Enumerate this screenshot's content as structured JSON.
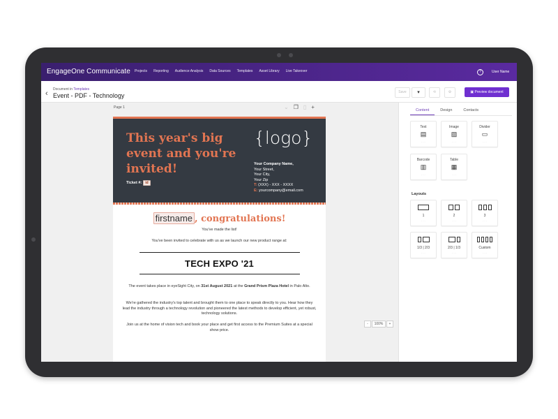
{
  "topbar": {
    "brand": "EngageOne Communicate",
    "nav": [
      "Projects",
      "Reporting",
      "Audience Analysis",
      "Data Sources",
      "Templates",
      "Asset Library",
      "Live Takeover"
    ],
    "help_icon": "?",
    "user_name": "User Name"
  },
  "doc": {
    "in_label": "Document in",
    "in_link": "Templates",
    "title": "Event - PDF - Technology",
    "toolbar": {
      "save_label": "Save",
      "dropdown_icon": "▾",
      "preview_label": "Preview document"
    }
  },
  "canvas": {
    "page_label": "Page 1",
    "zoom_value": "100%",
    "zoom_minus": "-",
    "zoom_plus": "+"
  },
  "document": {
    "headline": "This year's big event and you're invited!",
    "ticket_label": "Ticket #:",
    "ticket_tag": "id",
    "logo": "{logo}",
    "company_name": "Your Company Name,",
    "street": "Your Street,",
    "city": "Your City,",
    "zip": "Your Zip",
    "phone_label": "T:",
    "phone": "(XXX) - XXX - XXXX",
    "email_label": "E:",
    "email": "yourcompany@email.com",
    "firstname_field": "firstname",
    "congrats": ", congratulations!",
    "made_list": "You've made the list!",
    "invite": "You've been invited to celebrate with us as we launch our new product range at:",
    "event_name": "TECH EXPO '21",
    "p1_a": "The event takes place in eyeSight City, on ",
    "p1_date": "31st August 2021",
    "p1_b": " at the ",
    "p1_venue": "Grand Prism Plaza Hotel",
    "p1_c": " in Palo Alto.",
    "p2": "We're gathered the industry's top talent and brought them to one place to speak directly to you. Hear how they lead the industry through a technology revolution and pioneered the latest methods to develop efficient, yet robust, technology solutions.",
    "p3": "Join us at the home of vision tech and book your place and get first access to the Premium Suites at a special show price."
  },
  "panel": {
    "tabs": [
      "Content",
      "Design",
      "Contacts"
    ],
    "active_tab": "Content",
    "content_items": [
      {
        "label": "Text",
        "icon": "text-block-icon"
      },
      {
        "label": "Image",
        "icon": "image-icon"
      },
      {
        "label": "Divider",
        "icon": "divider-icon"
      },
      {
        "label": "Barcode",
        "icon": "barcode-icon"
      },
      {
        "label": "Table",
        "icon": "table-icon"
      }
    ],
    "layouts_heading": "Layouts",
    "layouts": [
      {
        "label": "1"
      },
      {
        "label": "2"
      },
      {
        "label": "3"
      },
      {
        "label": "1/3 | 2/3"
      },
      {
        "label": "2/3 | 1/3"
      },
      {
        "label": "Custom"
      }
    ]
  },
  "colors": {
    "accent_orange": "#e27552",
    "hero_bg": "#343a42",
    "brand_purple": "#6f2fd0",
    "topbar_purple": "#4a248a"
  }
}
